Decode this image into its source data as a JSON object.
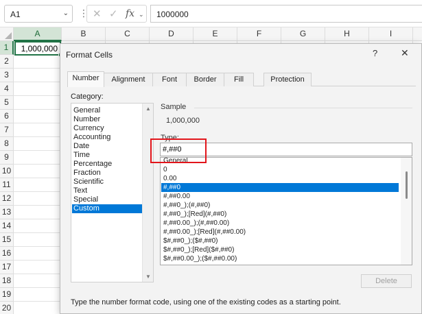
{
  "formula_bar": {
    "name_box": "A1",
    "separator": "⋮",
    "cancel_icon": "✕",
    "confirm_icon": "✓",
    "fx_label": "fx",
    "formula_value": "1000000"
  },
  "grid": {
    "columns": [
      "A",
      "B",
      "C",
      "D",
      "E",
      "F",
      "G",
      "H",
      "I"
    ],
    "rows": [
      "1",
      "2",
      "3",
      "4",
      "5",
      "6",
      "7",
      "8",
      "9",
      "10",
      "11",
      "12",
      "13",
      "14",
      "15",
      "16",
      "17",
      "18",
      "19",
      "20"
    ],
    "active_cell_value": "1,000,000",
    "accent_color": "#217346"
  },
  "dialog": {
    "title": "Format Cells",
    "help": "?",
    "close": "✕",
    "tabs": [
      "Number",
      "Alignment",
      "Font",
      "Border",
      "Fill",
      "Protection"
    ],
    "category_label": "Category:",
    "categories": [
      "General",
      "Number",
      "Currency",
      "Accounting",
      "Date",
      "Time",
      "Percentage",
      "Fraction",
      "Scientific",
      "Text",
      "Special",
      "Custom"
    ],
    "selected_category": "Custom",
    "sample_label": "Sample",
    "sample_value": "1,000,000",
    "type_label": "Type:",
    "type_value": "#,##0",
    "formats": [
      "General",
      "0",
      "0.00",
      "#,##0",
      "#,##0.00",
      "#,##0_);(#,##0)",
      "#,##0_);[Red](#,##0)",
      "#,##0.00_);(#,##0.00)",
      "#,##0.00_);[Red](#,##0.00)",
      "$#,##0_);($#,##0)",
      "$#,##0_);[Red]($#,##0)",
      "$#,##0.00_);($#,##0.00)"
    ],
    "selected_format": "#,##0",
    "delete_label": "Delete",
    "hint": "Type the number format code, using one of the existing codes as a starting point.",
    "selection_color": "#0078d7",
    "highlight_color": "#e2151b"
  }
}
